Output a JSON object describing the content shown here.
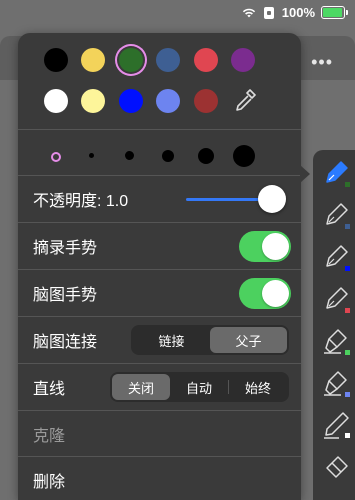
{
  "status": {
    "battery": "100%"
  },
  "colors": {
    "row1": [
      "#000000",
      "#f3d35a",
      "#2d6f2a",
      "#3e5f93",
      "#e04651",
      "#7b2c8f"
    ],
    "row2": [
      "#ffffff",
      "#fdf59a",
      "#0010ff",
      "#6d84f0",
      "#9c3232"
    ],
    "selected_index": 2,
    "eyedropper_icon": "eyedropper-icon"
  },
  "stroke_sizes": [
    "xs",
    "s",
    "m",
    "l",
    "xl",
    "xxl"
  ],
  "opacity": {
    "label": "不透明度: 1.0",
    "value": 1.0
  },
  "excerpt_gesture": {
    "label": "摘录手势",
    "on": true
  },
  "mindmap_gesture": {
    "label": "脑图手势",
    "on": true
  },
  "mindmap_link": {
    "label": "脑图连接",
    "options": [
      "链接",
      "父子"
    ],
    "selected": "父子"
  },
  "line": {
    "label": "直线",
    "options": [
      "关闭",
      "自动",
      "始终"
    ],
    "selected": "关闭"
  },
  "clone": {
    "label": "克隆"
  },
  "delete": {
    "label": "删除"
  },
  "tools": [
    {
      "name": "pen-icon",
      "mark": "#2d6f2a",
      "active": true
    },
    {
      "name": "pen-icon",
      "mark": "#3e5f93"
    },
    {
      "name": "pen-icon",
      "mark": "#0010ff"
    },
    {
      "name": "pen-icon",
      "mark": "#e04651"
    },
    {
      "name": "highlighter-icon",
      "mark": "#4cd15f"
    },
    {
      "name": "highlighter-icon",
      "mark": "#6d84f0"
    },
    {
      "name": "pencil-icon",
      "mark": "#ffffff"
    },
    {
      "name": "eraser-icon"
    }
  ]
}
